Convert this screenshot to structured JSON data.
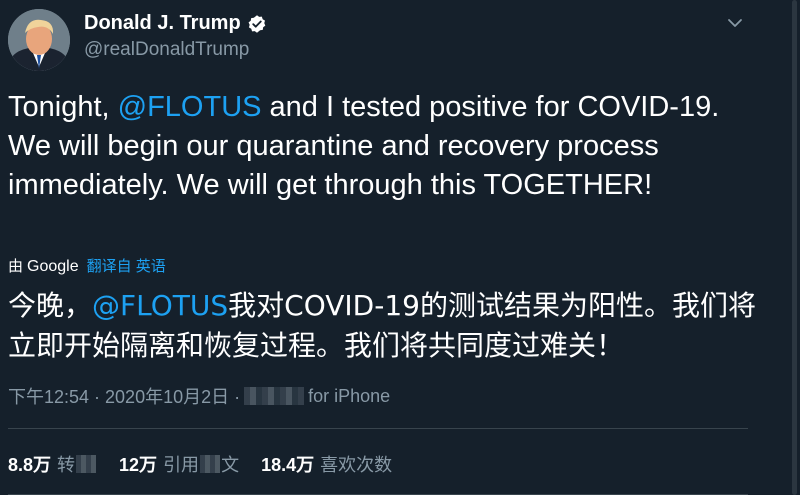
{
  "author": {
    "display_name": "Donald J. Trump",
    "handle": "@realDonaldTrump",
    "avatar_icon": "avatar-photo",
    "verified_icon": "verified-badge-icon"
  },
  "tweet": {
    "text_before": "Tonight, ",
    "mention": "@FLOTUS",
    "text_after": " and I tested positive for COVID-19. We will begin our quarantine and recovery process immediately. We will get through this TOGETHER!"
  },
  "translation": {
    "by_label": "由",
    "provider": "Google",
    "link": "翻译自 英语",
    "text_before": "今晚，",
    "mention": "@FLOTUS",
    "text_after": "我对COVID-19的测试结果为阳性。我们将立即开始隔离和恢复过程。我们将共同度过难关！"
  },
  "meta": {
    "time_date": "下午12:54 · 2020年10月2日 · ",
    "source": "for iPhone"
  },
  "stats": {
    "retweets_count": "8.8万",
    "retweets_label": "转",
    "quotes_count": "12万",
    "quotes_label_a": "引用",
    "quotes_label_b": "文",
    "likes_count": "18.4万",
    "likes_label": "喜欢次数"
  },
  "colors": {
    "background": "#15202b",
    "accent": "#1da1f2",
    "secondary_text": "#8899a6",
    "divider": "#38444d"
  }
}
